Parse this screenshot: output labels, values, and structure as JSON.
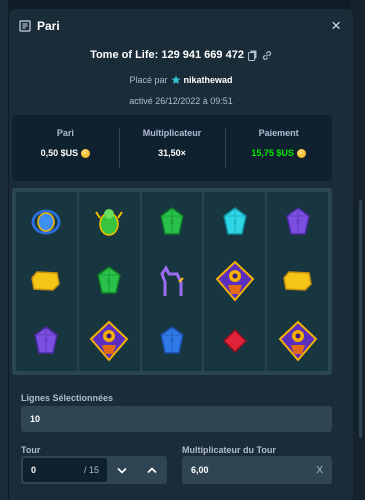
{
  "modal": {
    "title": "Pari",
    "game_name": "Tome of Life: 129 941 669 472",
    "placed_by_prefix": "Placé par",
    "user": "nikathewad",
    "activated": "activé 26/12/2022 à 09:51"
  },
  "stats": [
    {
      "label": "Pari",
      "value": "0,50 $US",
      "coin": true,
      "color": "#ffffff"
    },
    {
      "label": "Multiplicateur",
      "value": "31,50×",
      "coin": false,
      "color": "#ffffff"
    },
    {
      "label": "Paiement",
      "value": "15,75 $US",
      "coin": true,
      "color": "#00e701"
    }
  ],
  "board": {
    "columns": [
      [
        "blue-scarab",
        "yellow-gem",
        "purple-gem-a"
      ],
      [
        "green-beetle",
        "green-gem",
        "pharaoh-bonus"
      ],
      [
        "green-gem",
        "purple-jackal",
        "blue-gem"
      ],
      [
        "cyan-gem",
        "pharaoh-bonus",
        "red-gem"
      ],
      [
        "purple-gem-a",
        "yellow-gem",
        "pharaoh-bonus"
      ]
    ]
  },
  "lines": {
    "label": "Lignes Sélectionnées",
    "value": "10"
  },
  "tour": {
    "label": "Tour",
    "value": "0",
    "max": "/ 15"
  },
  "tour_multiplier": {
    "label": "Multiplicateur du Tour",
    "value": "6,00",
    "clear": "X"
  },
  "colors": {
    "accent_green": "#00e701",
    "bg": "#1a2c38",
    "panel": "#0f212e"
  }
}
